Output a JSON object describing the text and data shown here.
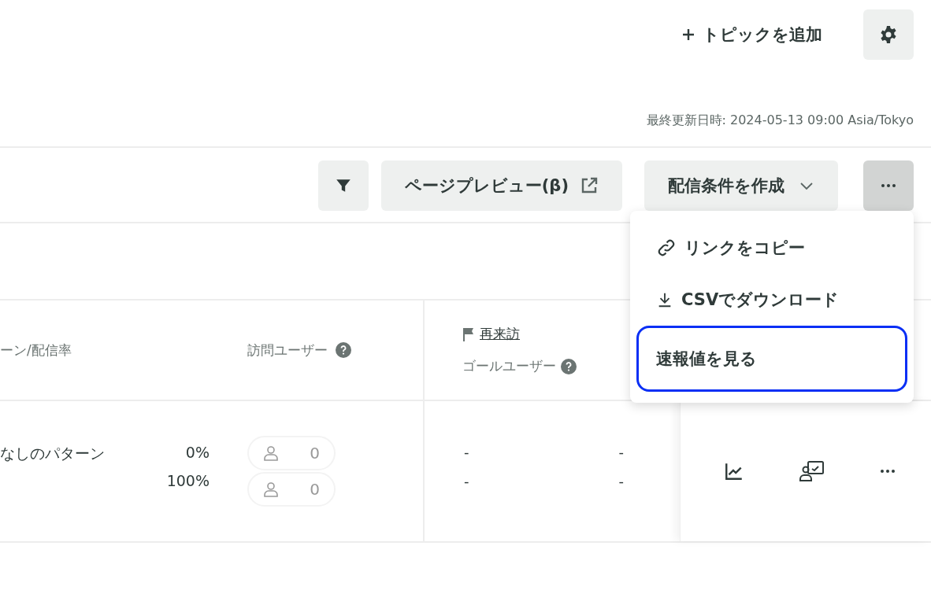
{
  "header": {
    "add_topic": "トピックを追加",
    "last_updated": "最終更新日時: 2024-05-13 09:00 Asia/Tokyo"
  },
  "toolbar": [
    {
      "kind": "filter"
    },
    {
      "kind": "preview",
      "label": "ページプレビュー(β)"
    },
    {
      "kind": "dropdown",
      "label": "配信条件を作成"
    },
    {
      "kind": "more",
      "active": true
    }
  ],
  "menu": {
    "items": [
      {
        "kind": "link",
        "label": "リンクをコピー",
        "focused": false
      },
      {
        "kind": "download",
        "label": "CSVでダウンロード",
        "focused": false
      },
      {
        "kind": "plain",
        "label": "速報値を見る",
        "focused": true
      }
    ]
  },
  "table": {
    "columns": [
      {
        "label": "ーン/配信率"
      },
      {
        "label": "訪問ユーザー",
        "help": true
      },
      {
        "group": "再来訪",
        "label": "ゴールユーザー",
        "help": true
      }
    ],
    "rows": [
      {
        "pattern": "なしのパターン",
        "rates": [
          "0%",
          "100%"
        ],
        "visitors": [
          "0",
          "0"
        ],
        "goal_users": [
          "-",
          "-"
        ],
        "column_4": [
          "-",
          "-"
        ]
      }
    ]
  }
}
